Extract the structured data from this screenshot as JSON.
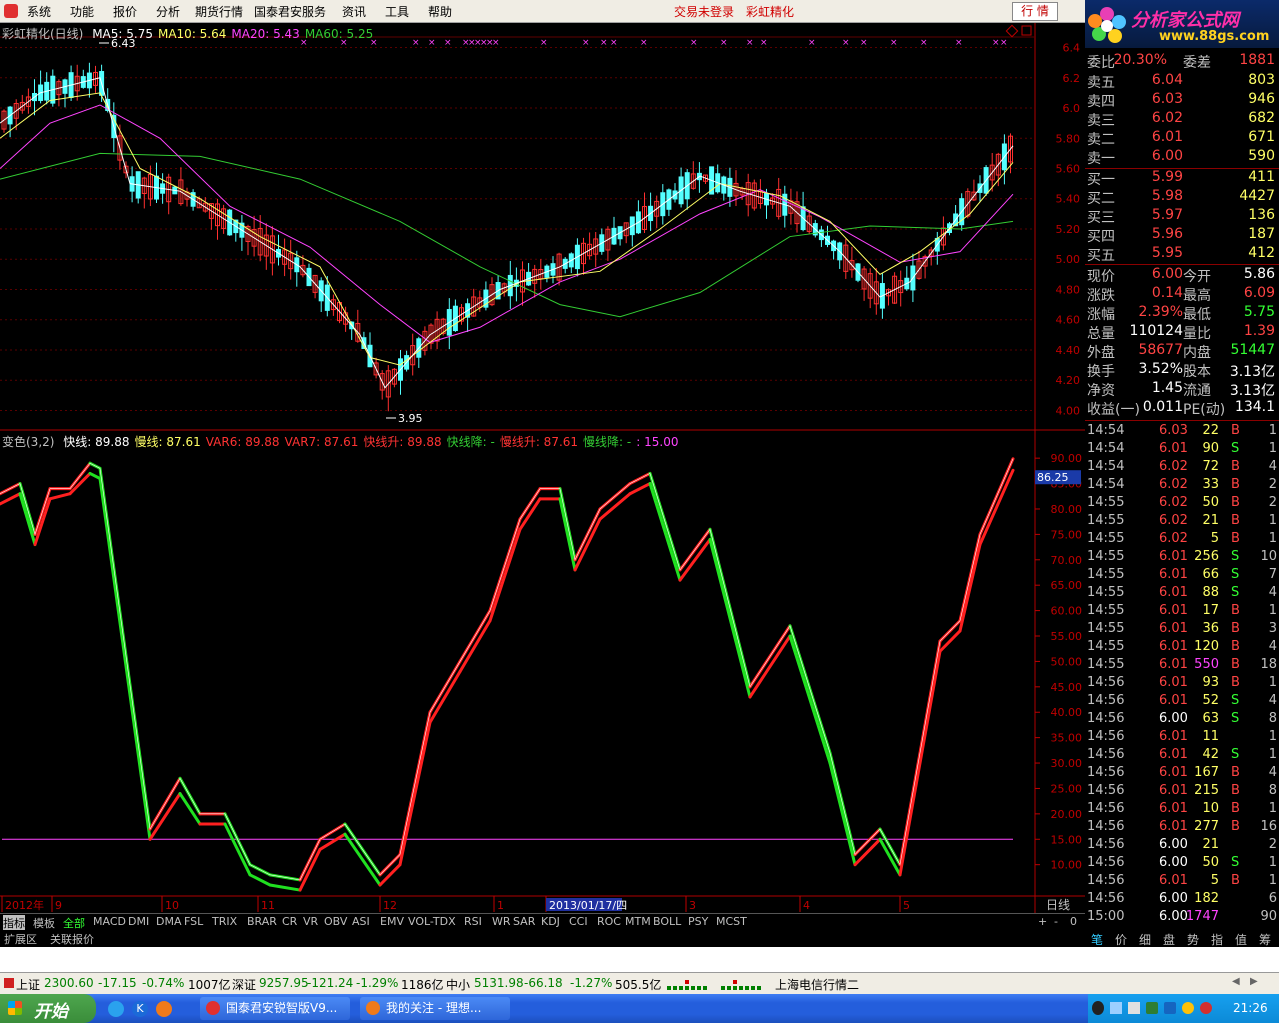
{
  "menu": {
    "items": [
      "系统",
      "功能",
      "报价",
      "分析",
      "期货行情",
      "国泰君安服务",
      "资讯",
      "工具",
      "帮助"
    ],
    "status_login": "交易未登录",
    "status_indicator": "彩虹精化",
    "hangqing_btn": "行 情",
    "logo_text": "分析家公式网",
    "logo_url": "www.88gs.com"
  },
  "chart_data": [
    {
      "type": "candlestick",
      "title": "彩虹精化(日线)",
      "legend": [
        {
          "label": "MA5: 5.75",
          "color": "#ffffff"
        },
        {
          "label": "MA10: 5.64",
          "color": "#ffff66"
        },
        {
          "label": "MA20: 5.43",
          "color": "#ff44ff"
        },
        {
          "label": "MA60: 5.25",
          "color": "#33cc33"
        }
      ],
      "y_ticks": [
        "6.4",
        "6.2",
        "6.0",
        "5.80",
        "5.60",
        "5.40",
        "5.20",
        "5.00",
        "4.80",
        "4.60",
        "4.40",
        "4.20",
        "4.00"
      ],
      "ylim": [
        3.95,
        6.43
      ],
      "high_label": "6.43",
      "low_label": "3.95",
      "ma60": [
        [
          0,
          5.53
        ],
        [
          100,
          5.7
        ],
        [
          200,
          5.68
        ],
        [
          300,
          5.53
        ],
        [
          400,
          5.25
        ],
        [
          480,
          4.95
        ],
        [
          560,
          4.7
        ],
        [
          620,
          4.62
        ],
        [
          700,
          4.78
        ],
        [
          790,
          5.15
        ],
        [
          870,
          5.22
        ],
        [
          960,
          5.2
        ],
        [
          1013,
          5.25
        ]
      ],
      "ma20": [
        [
          0,
          5.6
        ],
        [
          50,
          5.9
        ],
        [
          100,
          6.02
        ],
        [
          160,
          5.8
        ],
        [
          230,
          5.35
        ],
        [
          310,
          5.08
        ],
        [
          380,
          4.7
        ],
        [
          430,
          4.45
        ],
        [
          480,
          4.55
        ],
        [
          560,
          4.85
        ],
        [
          620,
          5.0
        ],
        [
          700,
          5.3
        ],
        [
          760,
          5.46
        ],
        [
          820,
          5.28
        ],
        [
          900,
          4.98
        ],
        [
          960,
          5.05
        ],
        [
          1013,
          5.43
        ]
      ],
      "ma10": [
        [
          0,
          5.8
        ],
        [
          50,
          6.05
        ],
        [
          100,
          6.1
        ],
        [
          140,
          5.6
        ],
        [
          200,
          5.4
        ],
        [
          260,
          5.15
        ],
        [
          320,
          4.95
        ],
        [
          370,
          4.35
        ],
        [
          400,
          4.3
        ],
        [
          450,
          4.55
        ],
        [
          520,
          4.85
        ],
        [
          600,
          4.92
        ],
        [
          660,
          5.2
        ],
        [
          720,
          5.5
        ],
        [
          780,
          5.42
        ],
        [
          830,
          5.25
        ],
        [
          880,
          4.9
        ],
        [
          920,
          5.05
        ],
        [
          970,
          5.3
        ],
        [
          1013,
          5.64
        ]
      ],
      "ma5": [
        [
          0,
          5.9
        ],
        [
          40,
          6.1
        ],
        [
          100,
          6.2
        ],
        [
          130,
          5.5
        ],
        [
          180,
          5.45
        ],
        [
          240,
          5.2
        ],
        [
          300,
          4.95
        ],
        [
          360,
          4.5
        ],
        [
          385,
          4.15
        ],
        [
          430,
          4.5
        ],
        [
          500,
          4.8
        ],
        [
          560,
          4.95
        ],
        [
          640,
          5.25
        ],
        [
          700,
          5.55
        ],
        [
          740,
          5.45
        ],
        [
          790,
          5.35
        ],
        [
          840,
          5.05
        ],
        [
          880,
          4.75
        ],
        [
          910,
          4.85
        ],
        [
          960,
          5.3
        ],
        [
          1013,
          5.75
        ]
      ]
    },
    {
      "type": "line",
      "title": "变色(3,2)",
      "legend": [
        {
          "label": "快线: 89.88",
          "color": "#ffffff"
        },
        {
          "label": "慢线: 87.61",
          "color": "#ffff66"
        },
        {
          "label": "VAR6: 89.88",
          "color": "#ff3333"
        },
        {
          "label": "VAR7: 87.61",
          "color": "#ff3333"
        },
        {
          "label": "快线升: 89.88",
          "color": "#ff3333"
        },
        {
          "label": "快线降: -",
          "color": "#33cc33"
        },
        {
          "label": "慢线升: 87.61",
          "color": "#ff3333"
        },
        {
          "label": "慢线降: -",
          "color": "#33cc33"
        },
        {
          "label": ": 15.00",
          "color": "#ff44ff"
        }
      ],
      "y_ticks": [
        "90.00",
        "85.00",
        "80.00",
        "75.00",
        "70.00",
        "65.00",
        "60.00",
        "55.00",
        "50.00",
        "45.00",
        "40.00",
        "35.00",
        "30.00",
        "25.00",
        "20.00",
        "15.00",
        "10.00"
      ],
      "ylim": [
        6,
        92
      ],
      "current_value": "86.25",
      "reference_line": 15.0,
      "fast": [
        [
          0,
          83
        ],
        [
          20,
          85
        ],
        [
          35,
          75
        ],
        [
          50,
          84
        ],
        [
          70,
          84
        ],
        [
          90,
          89
        ],
        [
          100,
          88
        ],
        [
          150,
          17
        ],
        [
          180,
          27
        ],
        [
          200,
          20
        ],
        [
          225,
          20
        ],
        [
          250,
          10
        ],
        [
          270,
          8
        ],
        [
          300,
          7
        ],
        [
          320,
          15
        ],
        [
          345,
          18
        ],
        [
          380,
          8
        ],
        [
          400,
          12
        ],
        [
          430,
          40
        ],
        [
          460,
          50
        ],
        [
          490,
          60
        ],
        [
          520,
          78
        ],
        [
          540,
          84
        ],
        [
          560,
          84
        ],
        [
          575,
          70
        ],
        [
          600,
          80
        ],
        [
          630,
          85
        ],
        [
          650,
          87
        ],
        [
          680,
          68
        ],
        [
          710,
          76
        ],
        [
          750,
          45
        ],
        [
          790,
          57
        ],
        [
          830,
          32
        ],
        [
          855,
          12
        ],
        [
          880,
          17
        ],
        [
          900,
          10
        ],
        [
          940,
          54
        ],
        [
          960,
          58
        ],
        [
          980,
          75
        ],
        [
          1013,
          89.88
        ]
      ],
      "slow": [
        [
          0,
          81
        ],
        [
          20,
          83
        ],
        [
          35,
          73
        ],
        [
          50,
          82
        ],
        [
          70,
          83
        ],
        [
          90,
          87
        ],
        [
          100,
          86
        ],
        [
          150,
          15
        ],
        [
          180,
          24
        ],
        [
          200,
          18
        ],
        [
          225,
          18
        ],
        [
          250,
          8
        ],
        [
          270,
          6
        ],
        [
          300,
          5
        ],
        [
          320,
          13
        ],
        [
          345,
          16
        ],
        [
          380,
          6
        ],
        [
          400,
          10
        ],
        [
          430,
          38
        ],
        [
          460,
          48
        ],
        [
          490,
          58
        ],
        [
          520,
          76
        ],
        [
          540,
          82
        ],
        [
          560,
          82
        ],
        [
          575,
          68
        ],
        [
          600,
          78
        ],
        [
          630,
          83
        ],
        [
          650,
          85
        ],
        [
          680,
          66
        ],
        [
          710,
          74
        ],
        [
          750,
          43
        ],
        [
          790,
          55
        ],
        [
          830,
          30
        ],
        [
          855,
          10
        ],
        [
          880,
          15
        ],
        [
          900,
          8
        ],
        [
          940,
          52
        ],
        [
          960,
          56
        ],
        [
          980,
          73
        ],
        [
          1013,
          87.61
        ]
      ],
      "x_labels": [
        "2012年",
        "9",
        "10",
        "11",
        "12",
        "1",
        "2013/01/17/四",
        "3",
        "4",
        "5"
      ],
      "period_label": "日线"
    }
  ],
  "order_book": {
    "header": {
      "label1": "委比",
      "v1": "20.30%",
      "label2": "委差",
      "v2": "1881"
    },
    "asks": [
      {
        "label": "卖五",
        "price": "6.04",
        "vol": "803"
      },
      {
        "label": "卖四",
        "price": "6.03",
        "vol": "946"
      },
      {
        "label": "卖三",
        "price": "6.02",
        "vol": "682"
      },
      {
        "label": "卖二",
        "price": "6.01",
        "vol": "671"
      },
      {
        "label": "卖一",
        "price": "6.00",
        "vol": "590"
      }
    ],
    "bids": [
      {
        "label": "买一",
        "price": "5.99",
        "vol": "411"
      },
      {
        "label": "买二",
        "price": "5.98",
        "vol": "4427"
      },
      {
        "label": "买三",
        "price": "5.97",
        "vol": "136"
      },
      {
        "label": "买四",
        "price": "5.96",
        "vol": "187"
      },
      {
        "label": "买五",
        "price": "5.95",
        "vol": "412"
      }
    ]
  },
  "quote": [
    {
      "l1": "现价",
      "v1": "6.00",
      "c1": "#ff4444",
      "l2": "今开",
      "v2": "5.86",
      "c2": "#ffffff"
    },
    {
      "l1": "涨跌",
      "v1": "0.14",
      "c1": "#ff4444",
      "l2": "最高",
      "v2": "6.09",
      "c2": "#ff4444"
    },
    {
      "l1": "涨幅",
      "v1": "2.39%",
      "c1": "#ff4444",
      "l2": "最低",
      "v2": "5.75",
      "c2": "#33ff33"
    },
    {
      "l1": "总量",
      "v1": "110124",
      "c1": "#ffffff",
      "l2": "量比",
      "v2": "1.39",
      "c2": "#ff4444"
    },
    {
      "l1": "外盘",
      "v1": "58677",
      "c1": "#ff4444",
      "l2": "内盘",
      "v2": "51447",
      "c2": "#33ff33"
    },
    {
      "l1": "换手",
      "v1": "3.52%",
      "c1": "#ffffff",
      "l2": "股本",
      "v2": "3.13亿",
      "c2": "#ffffff"
    },
    {
      "l1": "净资",
      "v1": "1.45",
      "c1": "#ffffff",
      "l2": "流通",
      "v2": "3.13亿",
      "c2": "#ffffff"
    },
    {
      "l1": "收益(一)",
      "v1": "0.011",
      "c1": "#ffffff",
      "l2": "PE(动)",
      "v2": "134.1",
      "c2": "#ffffff"
    }
  ],
  "ticks": [
    {
      "t": "14:54",
      "p": "6.03",
      "v": "22",
      "s": "B",
      "n": "1"
    },
    {
      "t": "14:54",
      "p": "6.01",
      "v": "90",
      "s": "S",
      "n": "1"
    },
    {
      "t": "14:54",
      "p": "6.02",
      "v": "72",
      "s": "B",
      "n": "4"
    },
    {
      "t": "14:54",
      "p": "6.02",
      "v": "33",
      "s": "B",
      "n": "2"
    },
    {
      "t": "14:55",
      "p": "6.02",
      "v": "50",
      "s": "B",
      "n": "2"
    },
    {
      "t": "14:55",
      "p": "6.02",
      "v": "21",
      "s": "B",
      "n": "1"
    },
    {
      "t": "14:55",
      "p": "6.02",
      "v": "5",
      "s": "B",
      "n": "1"
    },
    {
      "t": "14:55",
      "p": "6.01",
      "v": "256",
      "s": "S",
      "n": "10"
    },
    {
      "t": "14:55",
      "p": "6.01",
      "v": "66",
      "s": "S",
      "n": "7"
    },
    {
      "t": "14:55",
      "p": "6.01",
      "v": "88",
      "s": "S",
      "n": "4"
    },
    {
      "t": "14:55",
      "p": "6.01",
      "v": "17",
      "s": "B",
      "n": "1"
    },
    {
      "t": "14:55",
      "p": "6.01",
      "v": "36",
      "s": "B",
      "n": "3"
    },
    {
      "t": "14:55",
      "p": "6.01",
      "v": "120",
      "s": "B",
      "n": "4"
    },
    {
      "t": "14:55",
      "p": "6.01",
      "v": "550",
      "s": "B",
      "n": "18"
    },
    {
      "t": "14:56",
      "p": "6.01",
      "v": "93",
      "s": "B",
      "n": "1"
    },
    {
      "t": "14:56",
      "p": "6.01",
      "v": "52",
      "s": "S",
      "n": "4"
    },
    {
      "t": "14:56",
      "p": "6.00",
      "v": "63",
      "s": "S",
      "n": "8"
    },
    {
      "t": "14:56",
      "p": "6.01",
      "v": "11",
      "s": "",
      "n": "1"
    },
    {
      "t": "14:56",
      "p": "6.01",
      "v": "42",
      "s": "S",
      "n": "1"
    },
    {
      "t": "14:56",
      "p": "6.01",
      "v": "167",
      "s": "B",
      "n": "4"
    },
    {
      "t": "14:56",
      "p": "6.01",
      "v": "215",
      "s": "B",
      "n": "8"
    },
    {
      "t": "14:56",
      "p": "6.01",
      "v": "10",
      "s": "B",
      "n": "1"
    },
    {
      "t": "14:56",
      "p": "6.01",
      "v": "277",
      "s": "B",
      "n": "16"
    },
    {
      "t": "14:56",
      "p": "6.00",
      "v": "21",
      "s": "",
      "n": "2"
    },
    {
      "t": "14:56",
      "p": "6.00",
      "v": "50",
      "s": "S",
      "n": "1"
    },
    {
      "t": "14:56",
      "p": "6.01",
      "v": "5",
      "s": "B",
      "n": "1"
    },
    {
      "t": "14:56",
      "p": "6.00",
      "v": "182",
      "s": "",
      "n": "6"
    },
    {
      "t": "15:00",
      "p": "6.00",
      "v": "1747",
      "s": "",
      "n": "90"
    }
  ],
  "indicator_tabs": [
    "指标",
    "模板",
    "全部",
    "MACD",
    "DMI",
    "DMA",
    "FSL",
    "TRIX",
    "BRAR",
    "CR",
    "VR",
    "OBV",
    "ASI",
    "EMV",
    "VOL-TDX",
    "RSI",
    "WR",
    "SAR",
    "KDJ",
    "CCI",
    "ROC",
    "MTM",
    "BOLL",
    "PSY",
    "MCST"
  ],
  "tab_controls": [
    "+",
    "-",
    "0"
  ],
  "ext_tabs": [
    "扩展区",
    "关联报价"
  ],
  "right_tabs": [
    "笔",
    "价",
    "细",
    "盘",
    "势",
    "指",
    "值",
    "筹"
  ],
  "statusbar": {
    "sh_label": "上证",
    "sh_val": "2300.60",
    "sh_chg": "-17.15",
    "sh_pct": "-0.74%",
    "sh_amt": "1007亿",
    "sz_label": "深证",
    "sz_val": "9257.95",
    "sz_chg": "-121.24",
    "sz_pct": "-1.29%",
    "sz_amt": "1186亿",
    "zx_label": "中小",
    "zx_val": "5131.98",
    "zx_chg": "-66.18",
    "zx_pct": "-1.27%",
    "zx_amt": "505.5亿",
    "server": "上海电信行情二"
  },
  "taskbar": {
    "start": "开始",
    "task1": "国泰君安锐智版V9...",
    "task2": "我的关注 - 理想...",
    "clock": "21:26"
  }
}
